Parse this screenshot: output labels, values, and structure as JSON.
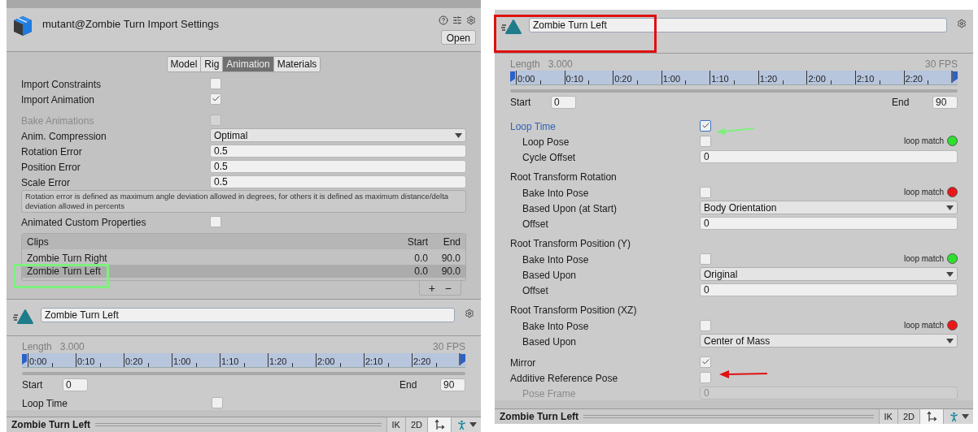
{
  "import_settings": {
    "title": "mutant@Zombie Turn Import Settings",
    "open_button": "Open",
    "tabs": [
      {
        "label": "Model",
        "selected": false
      },
      {
        "label": "Rig",
        "selected": false
      },
      {
        "label": "Animation",
        "selected": true
      },
      {
        "label": "Materials",
        "selected": false
      }
    ],
    "rows": [
      {
        "kind": "checkbox",
        "label": "Import Constraints",
        "checked": false,
        "disabled": false
      },
      {
        "kind": "checkbox",
        "label": "Import Animation",
        "checked": true,
        "disabled": false
      },
      {
        "kind": "checkbox",
        "label": "Bake Animations",
        "checked": false,
        "disabled": true,
        "separated": true
      },
      {
        "kind": "dropdown",
        "label": "Anim. Compression",
        "value": "Optimal"
      },
      {
        "kind": "text",
        "label": "Rotation Error",
        "value": "0.5"
      },
      {
        "kind": "text",
        "label": "Position Error",
        "value": "0.5"
      },
      {
        "kind": "text",
        "label": "Scale Error",
        "value": "0.5"
      },
      {
        "kind": "help",
        "text": "Rotation error is defined as maximum angle deviation allowed in degrees, for others it is defined as maximum distance/delta deviation allowed in percents"
      },
      {
        "kind": "checkbox",
        "label": "Animated Custom Properties",
        "checked": false,
        "disabled": false
      }
    ],
    "clips": {
      "columns": [
        "Clips",
        "Start",
        "End"
      ],
      "rows": [
        {
          "name": "Zombie Turn Right",
          "start": "0.0",
          "end": "90.0",
          "selected": false
        },
        {
          "name": "Zombie Turn Left",
          "start": "0.0",
          "end": "90.0",
          "selected": true
        }
      ],
      "add_button": "+",
      "remove_button": "−"
    }
  },
  "clip_preview": {
    "name": "Zombie Turn Left",
    "length_label": "Length",
    "length": "3.000",
    "fps": "30 FPS",
    "ticks": [
      "0:00",
      "0:10",
      "0:20",
      "1:00",
      "1:10",
      "1:20",
      "2:00",
      "2:10",
      "2:20"
    ],
    "start_label": "Start",
    "start": "0",
    "end_label": "End",
    "end": "90",
    "rows": [
      {
        "kind": "checkbox",
        "label": "Loop Time",
        "checked": false,
        "focused": false
      }
    ],
    "footer": {
      "title": "Zombie Turn Left",
      "buttons": [
        "IK",
        "2D"
      ]
    }
  },
  "clip_inspector": {
    "name": "Zombie Turn Left",
    "length_label": "Length",
    "length": "3.000",
    "fps": "30 FPS",
    "ticks": [
      "0:00",
      "0:10",
      "0:20",
      "1:00",
      "1:10",
      "1:20",
      "2:00",
      "2:10",
      "2:20"
    ],
    "start_label": "Start",
    "start": "0",
    "end_label": "End",
    "end": "90",
    "rows": [
      {
        "kind": "checkbox",
        "label": "Loop Time",
        "checked": true,
        "focused": true,
        "separated": true,
        "children": [
          {
            "kind": "checkbox",
            "label": "Loop Pose",
            "checked": false,
            "loop_match": {
              "label": "loop match",
              "color": "#2ee02e"
            }
          },
          {
            "kind": "text",
            "label": "Cycle Offset",
            "value": "0"
          }
        ]
      },
      {
        "kind": "group",
        "label": "Root Transform Rotation",
        "children": [
          {
            "kind": "checkbox",
            "label": "Bake Into Pose",
            "checked": false,
            "loop_match": {
              "label": "loop match",
              "color": "#e81818"
            }
          },
          {
            "kind": "dropdown",
            "label": "Based Upon (at Start)",
            "value": "Body Orientation"
          },
          {
            "kind": "text",
            "label": "Offset",
            "value": "0"
          }
        ]
      },
      {
        "kind": "group",
        "label": "Root Transform Position (Y)",
        "children": [
          {
            "kind": "checkbox",
            "label": "Bake Into Pose",
            "checked": false,
            "loop_match": {
              "label": "loop match",
              "color": "#2ee02e"
            }
          },
          {
            "kind": "dropdown",
            "label": "Based Upon",
            "value": "Original"
          },
          {
            "kind": "text",
            "label": "Offset",
            "value": "0"
          }
        ]
      },
      {
        "kind": "group",
        "label": "Root Transform Position (XZ)",
        "children": [
          {
            "kind": "checkbox",
            "label": "Bake Into Pose",
            "checked": false,
            "loop_match": {
              "label": "loop match",
              "color": "#e81818"
            }
          },
          {
            "kind": "dropdown",
            "label": "Based Upon",
            "value": "Center of Mass"
          }
        ]
      },
      {
        "kind": "checkbox",
        "label": "Mirror",
        "checked": true,
        "separated": true
      },
      {
        "kind": "checkbox",
        "label": "Additive Reference Pose",
        "checked": false,
        "children": [
          {
            "kind": "text",
            "label": "Pose Frame",
            "value": "0",
            "disabled": true
          }
        ]
      }
    ],
    "footer": {
      "title": "Zombie Turn Left",
      "buttons": [
        "IK",
        "2D"
      ]
    }
  }
}
